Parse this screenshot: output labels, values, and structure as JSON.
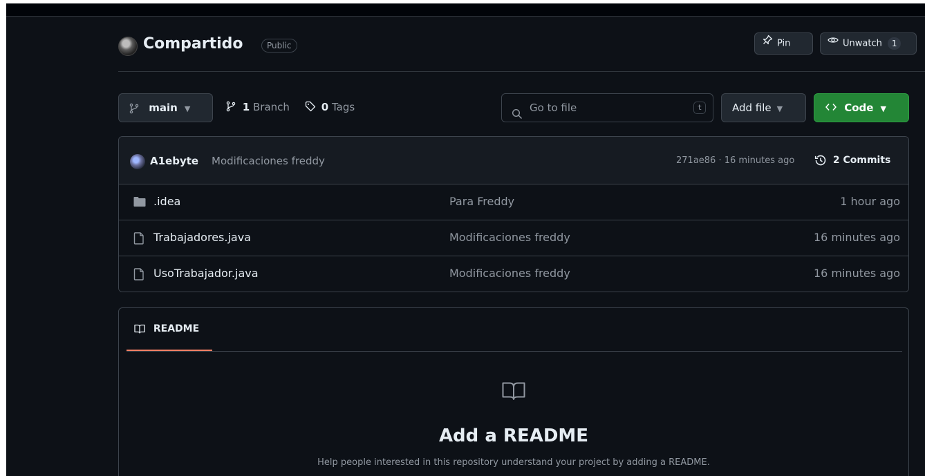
{
  "repo": {
    "name": "Compartido",
    "visibility": "Public",
    "pin_label": "Pin",
    "unwatch_label": "Unwatch",
    "watch_count": "1"
  },
  "toolbar": {
    "branch": "main",
    "branches_count": "1",
    "branches_label": "Branch",
    "tags_count": "0",
    "tags_label": "Tags",
    "search_placeholder": "Go to file",
    "search_shortcut": "t",
    "add_file_label": "Add file",
    "code_label": "Code"
  },
  "latest_commit": {
    "author": "A1ebyte",
    "message": "Modificaciones freddy",
    "hash_time": "271ae86 · 16 minutes ago",
    "commits_label": "2 Commits"
  },
  "files": [
    {
      "name": ".idea",
      "type": "folder",
      "commit": "Para Freddy",
      "time": "1 hour ago"
    },
    {
      "name": "Trabajadores.java",
      "type": "file",
      "commit": "Modificaciones freddy",
      "time": "16 minutes ago"
    },
    {
      "name": "UsoTrabajador.java",
      "type": "file",
      "commit": "Modificaciones freddy",
      "time": "16 minutes ago"
    }
  ],
  "readme": {
    "tab_label": "README",
    "title": "Add a README",
    "help_text": "Help people interested in this repository understand your project by adding a README."
  },
  "colors": {
    "background": "#0d1117",
    "code_button": "#238636",
    "tab_underline": "#f78166",
    "border": "#3d444d"
  }
}
